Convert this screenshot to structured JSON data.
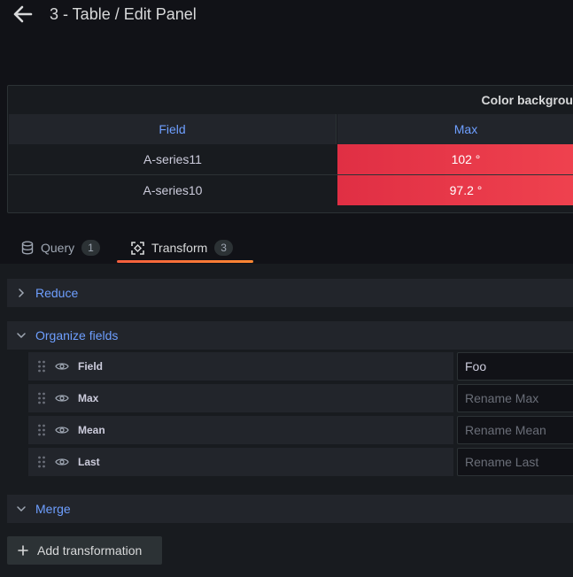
{
  "header": {
    "title": "3 - Table / Edit Panel"
  },
  "panel": {
    "title": "Color backgrou",
    "columns": [
      "Field",
      "Max"
    ],
    "rows": [
      {
        "field": "A-series11",
        "max": "102 °"
      },
      {
        "field": "A-series10",
        "max": "97.2 °"
      }
    ],
    "max_cell_color": "#e02f44"
  },
  "tabs": [
    {
      "label": "Query",
      "count": "1",
      "icon": "database-icon"
    },
    {
      "label": "Transform",
      "count": "3",
      "icon": "transform-icon"
    }
  ],
  "transformations": {
    "reduce": {
      "title": "Reduce"
    },
    "organize": {
      "title": "Organize fields",
      "fields": [
        {
          "label": "Field",
          "value": "Foo",
          "placeholder": ""
        },
        {
          "label": "Max",
          "value": "",
          "placeholder": "Rename Max"
        },
        {
          "label": "Mean",
          "value": "",
          "placeholder": "Rename Mean"
        },
        {
          "label": "Last",
          "value": "",
          "placeholder": "Rename Last"
        }
      ]
    },
    "merge": {
      "title": "Merge"
    }
  },
  "add_transformation": {
    "label": "Add transformation"
  },
  "colors": {
    "accent": "#6e9fff",
    "tab_underline": "#f55f3e"
  }
}
